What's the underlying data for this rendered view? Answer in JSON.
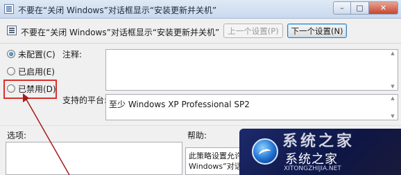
{
  "window": {
    "title": "不要在“关闭 Windows”对话框显示“安装更新并关机”",
    "controls": [
      "–",
      "□",
      "✕"
    ]
  },
  "header": {
    "policy_title": "不要在“关闭 Windows”对话框显示“安装更新并关机”",
    "prev_button": "上一个设置(P)",
    "next_button": "下一个设置(N)"
  },
  "state_options": [
    {
      "label": "未配置(C)",
      "selected": true
    },
    {
      "label": "已启用(E)",
      "selected": false
    },
    {
      "label": "已禁用(D)",
      "selected": false
    }
  ],
  "fields": {
    "comment_label": "注释:",
    "comment_value": "",
    "platform_label": "支持的平台:",
    "platform_value": "至少 Windows XP Professional SP2"
  },
  "lower": {
    "options_label": "选项:",
    "help_label": "帮助:",
    "help_text_line1": "此策略设置允许",
    "help_text_line2": "Windows”对话"
  },
  "watermark": {
    "brand_top": "系统之家",
    "brand": "系统之家",
    "url": "XITONGZHIJIA.NET"
  },
  "colors": {
    "highlight_box": "#d9302a",
    "arrow": "#a51b1b"
  }
}
